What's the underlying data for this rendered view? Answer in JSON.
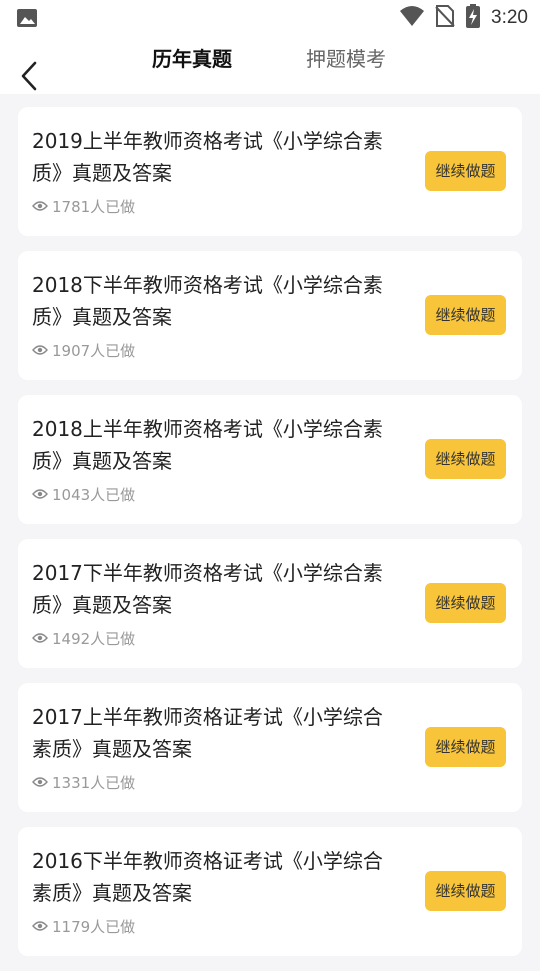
{
  "status_bar": {
    "time": "3:20",
    "icons": [
      "image-icon",
      "wifi-icon",
      "no-sim-icon",
      "battery-charging-icon"
    ]
  },
  "header": {
    "back_icon": "chevron-left-icon",
    "tabs": [
      {
        "label": "历年真题",
        "active": true
      },
      {
        "label": "押题模考",
        "active": false
      }
    ]
  },
  "exams": [
    {
      "title": "2019上半年教师资格考试《小学综合素质》真题及答案",
      "views": "1781人已做",
      "button": "继续做题"
    },
    {
      "title": "2018下半年教师资格考试《小学综合素质》真题及答案",
      "views": "1907人已做",
      "button": "继续做题"
    },
    {
      "title": "2018上半年教师资格考试《小学综合素质》真题及答案",
      "views": "1043人已做",
      "button": "继续做题"
    },
    {
      "title": "2017下半年教师资格考试《小学综合素质》真题及答案",
      "views": "1492人已做",
      "button": "继续做题"
    },
    {
      "title": "2017上半年教师资格证考试《小学综合素质》真题及答案",
      "views": "1331人已做",
      "button": "继续做题"
    },
    {
      "title": "2016下半年教师资格证考试《小学综合素质》真题及答案",
      "views": "1179人已做",
      "button": "继续做题"
    }
  ],
  "colors": {
    "accent": "#f7c43a",
    "background": "#f5f5f7",
    "card": "#ffffff",
    "muted_text": "#999999"
  }
}
